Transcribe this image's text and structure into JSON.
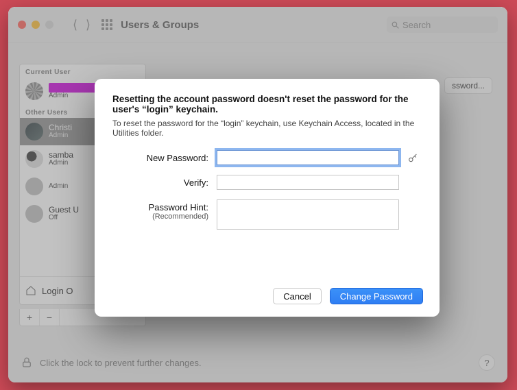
{
  "toolbar": {
    "title": "Users & Groups",
    "search_placeholder": "Search"
  },
  "sidebar": {
    "current_heading": "Current User",
    "other_heading": "Other Users",
    "current_user": {
      "name_redacted": true,
      "role": "Admin"
    },
    "users": [
      {
        "name": "Christi",
        "role": "Admin",
        "avatar": "dark",
        "selected": true
      },
      {
        "name": "samba",
        "role": "Admin",
        "avatar": "yin",
        "selected": false
      },
      {
        "name": "",
        "role": "Admin",
        "avatar": "plain",
        "selected": false
      },
      {
        "name": "Guest U",
        "role": "Off",
        "avatar": "plain",
        "selected": false
      }
    ],
    "login_options_label": "Login O",
    "plus": "+",
    "minus": "−"
  },
  "right_panel": {
    "change_password_button": "ssword..."
  },
  "lockbar": {
    "text": "Click the lock to prevent further changes.",
    "help_label": "?"
  },
  "modal": {
    "title": "Resetting the account password doesn't reset the password for the user's “login” keychain.",
    "subtitle": "To reset the password for the “login” keychain, use Keychain Access, located in the Utilities folder.",
    "field_new_password": "New Password:",
    "field_verify": "Verify:",
    "field_hint": "Password Hint:",
    "field_hint_sub": "(Recommended)",
    "new_password_value": "",
    "verify_value": "",
    "hint_value": "",
    "cancel_label": "Cancel",
    "confirm_label": "Change Password"
  }
}
